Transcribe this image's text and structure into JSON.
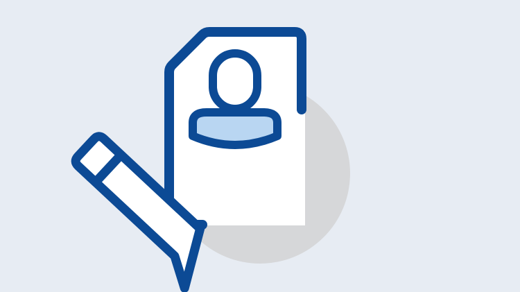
{
  "illustration": {
    "icon": "profile-document-edit-icon",
    "parts": {
      "backdrop": "circle",
      "document": "document-page-icon",
      "person": "user-avatar-icon",
      "pencil": "pencil-icon"
    },
    "colors": {
      "background": "#e7ecf3",
      "outline": "#0c4a95",
      "paper": "#ffffff",
      "backdrop_circle": "#d6d7d9",
      "person_body_fill": "#b9d6f2",
      "pencil_fill": "#ffffff"
    }
  }
}
